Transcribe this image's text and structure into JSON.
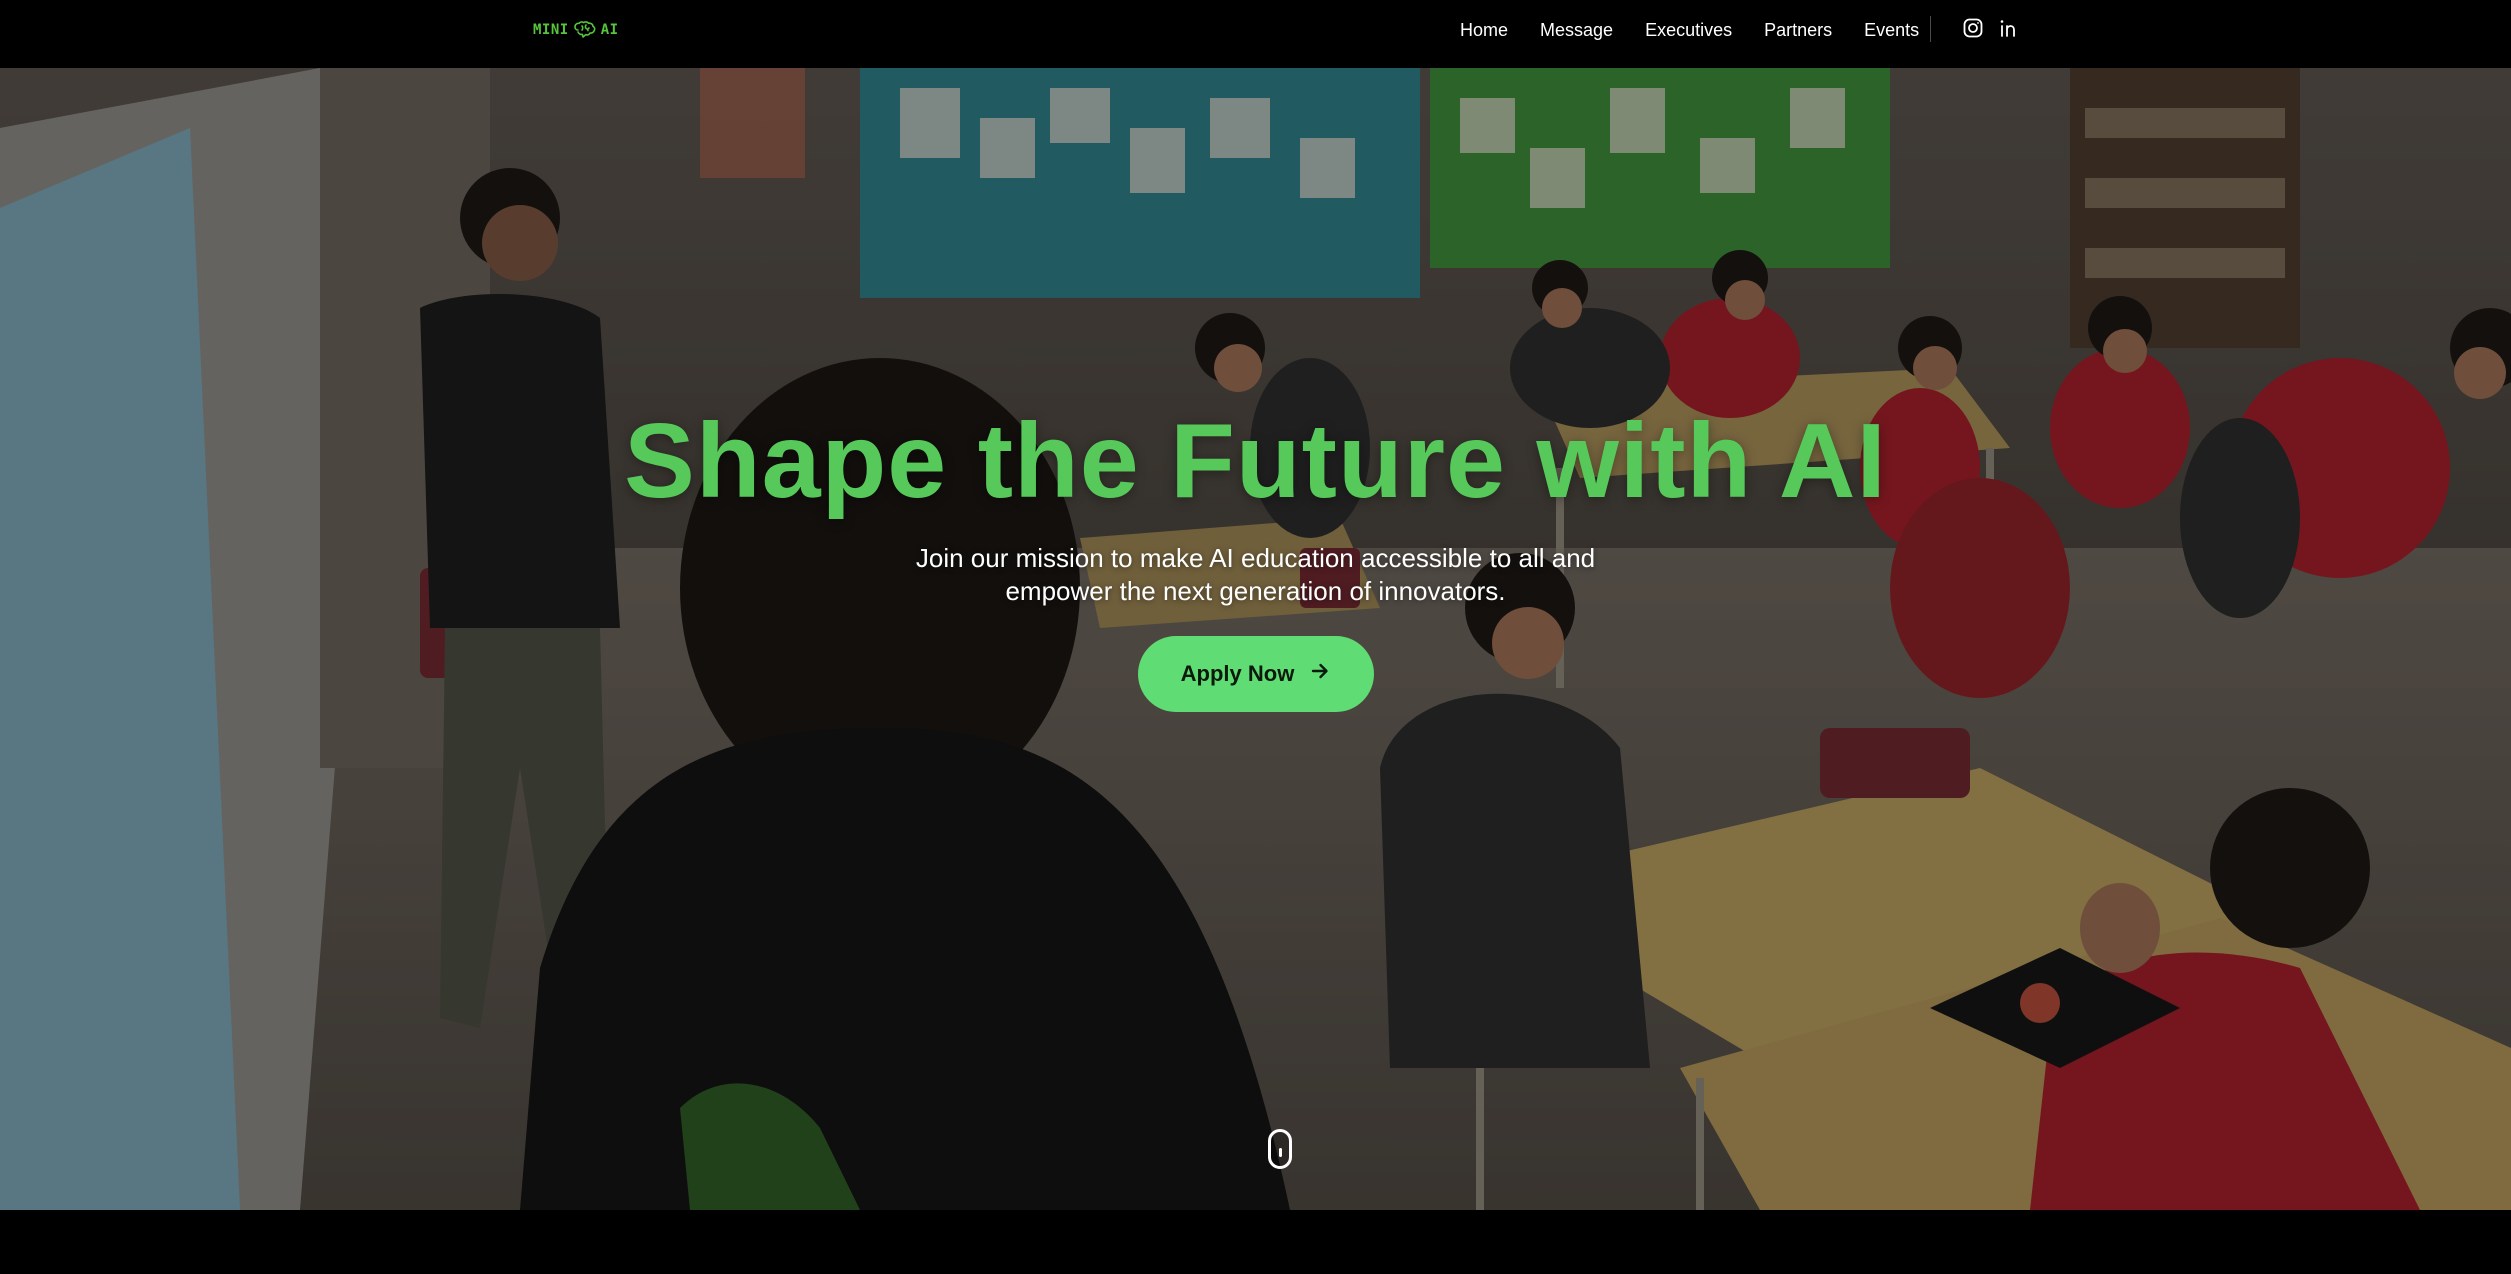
{
  "brand": {
    "logo_text_left": "MINI",
    "logo_text_right": "AI",
    "logo_icon": "brain-icon",
    "logo_color": "#56c43c"
  },
  "nav": {
    "items": [
      {
        "label": "Home"
      },
      {
        "label": "Message"
      },
      {
        "label": "Executives"
      },
      {
        "label": "Partners"
      },
      {
        "label": "Events"
      }
    ],
    "social": [
      {
        "icon": "instagram-icon"
      },
      {
        "icon": "linkedin-icon"
      }
    ]
  },
  "hero": {
    "title": "Shape the Future with AI",
    "subtitle": "Join our mission to make AI education accessible to all and empower the next generation of innovators.",
    "cta_label": "Apply Now",
    "cta_icon": "arrow-right-icon",
    "scroll_icon": "mouse-scroll-icon",
    "title_color": "#56c95a",
    "cta_color": "#5fdc73"
  }
}
